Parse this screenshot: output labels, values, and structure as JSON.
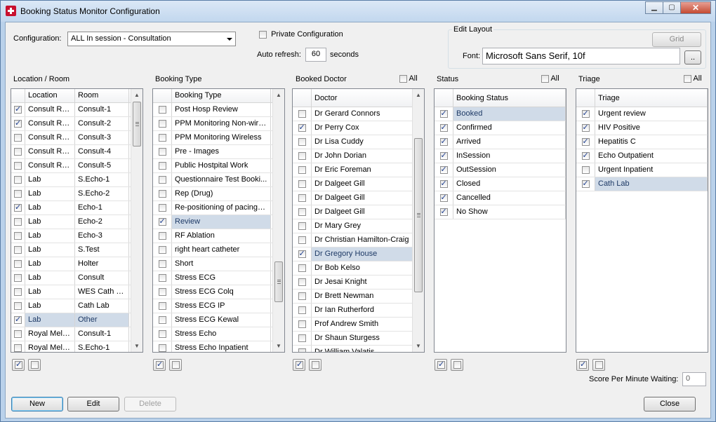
{
  "window": {
    "title": "Booking Status Monitor Configuration",
    "minimize_glyph": "▁",
    "maximize_glyph": "▢",
    "close_glyph": "✕"
  },
  "config": {
    "label": "Configuration:",
    "selected": "ALL In session - Consultation",
    "private_label": "Private Configuration",
    "private_checked": false,
    "auto_refresh_label": "Auto refresh:",
    "auto_refresh_value": "60",
    "auto_refresh_unit": "seconds"
  },
  "edit_layout": {
    "title": "Edit Layout",
    "grid_button": "Grid",
    "font_label": "Font:",
    "font_value": "Microsoft Sans Serif, 10f",
    "browse_button": ".."
  },
  "location": {
    "title": "Location / Room",
    "col_location": "Location",
    "col_room": "Room",
    "rows": [
      {
        "location": "Consult Ro...",
        "room": "Consult-1",
        "checked": true
      },
      {
        "location": "Consult Ro...",
        "room": "Consult-2",
        "checked": true
      },
      {
        "location": "Consult Ro...",
        "room": "Consult-3",
        "checked": false
      },
      {
        "location": "Consult Ro...",
        "room": "Consult-4",
        "checked": false
      },
      {
        "location": "Consult Ro...",
        "room": "Consult-5",
        "checked": false
      },
      {
        "location": "Lab",
        "room": "S.Echo-1",
        "checked": false
      },
      {
        "location": "Lab",
        "room": "S.Echo-2",
        "checked": false
      },
      {
        "location": "Lab",
        "room": "Echo-1",
        "checked": true
      },
      {
        "location": "Lab",
        "room": "Echo-2",
        "checked": false
      },
      {
        "location": "Lab",
        "room": "Echo-3",
        "checked": false
      },
      {
        "location": "Lab",
        "room": "S.Test",
        "checked": false
      },
      {
        "location": "Lab",
        "room": "Holter",
        "checked": false
      },
      {
        "location": "Lab",
        "room": "Consult",
        "checked": false
      },
      {
        "location": "Lab",
        "room": "WES Cath L...",
        "checked": false
      },
      {
        "location": "Lab",
        "room": "Cath Lab",
        "checked": false
      },
      {
        "location": "Lab",
        "room": "Other",
        "checked": true,
        "selected": true
      },
      {
        "location": "Royal Melb...",
        "room": "Consult-1",
        "checked": false
      },
      {
        "location": "Royal Melb...",
        "room": "S.Echo-1",
        "checked": false
      }
    ]
  },
  "booking_type": {
    "title": "Booking Type",
    "col": "Booking Type",
    "rows": [
      {
        "name": "Post Hosp Review",
        "checked": false
      },
      {
        "name": "PPM Monitoring Non-wirel...",
        "checked": false
      },
      {
        "name": "PPM Monitoring Wireless",
        "checked": false
      },
      {
        "name": "Pre - Images",
        "checked": false
      },
      {
        "name": "Public Hostpital Work",
        "checked": false
      },
      {
        "name": "Questionnaire Test Booki...",
        "checked": false
      },
      {
        "name": "Rep (Drug)",
        "checked": false
      },
      {
        "name": "Re-positioning of pacing l...",
        "checked": false
      },
      {
        "name": "Review",
        "checked": true,
        "selected": true
      },
      {
        "name": "RF Ablation",
        "checked": false
      },
      {
        "name": "right heart catheter",
        "checked": false
      },
      {
        "name": "Short",
        "checked": false
      },
      {
        "name": "Stress ECG",
        "checked": false
      },
      {
        "name": "Stress ECG Colq",
        "checked": false
      },
      {
        "name": "Stress ECG IP",
        "checked": false
      },
      {
        "name": "Stress ECG Kewal",
        "checked": false
      },
      {
        "name": "Stress Echo",
        "checked": false
      },
      {
        "name": "Stress Echo  Inpatient",
        "checked": false
      }
    ]
  },
  "doctor": {
    "title": "Booked Doctor",
    "all_label": "All",
    "col": "Doctor",
    "rows": [
      {
        "name": "Dr Gerard Connors",
        "checked": false
      },
      {
        "name": "Dr Perry Cox",
        "checked": true
      },
      {
        "name": "Dr Lisa Cuddy",
        "checked": false
      },
      {
        "name": "Dr John Dorian",
        "checked": false
      },
      {
        "name": "Dr Eric Foreman",
        "checked": false
      },
      {
        "name": "Dr Dalgeet Gill",
        "checked": false
      },
      {
        "name": "Dr Dalgeet Gill",
        "checked": false
      },
      {
        "name": "Dr Dalgeet Gill",
        "checked": false
      },
      {
        "name": "Dr Mary Grey",
        "checked": false
      },
      {
        "name": "Dr Christian Hamilton-Craig",
        "checked": false
      },
      {
        "name": "Dr Gregory House",
        "checked": true,
        "selected": true
      },
      {
        "name": "Dr Bob Kelso",
        "checked": false
      },
      {
        "name": "Dr Jesai Knight",
        "checked": false
      },
      {
        "name": "Dr Brett Newman",
        "checked": false
      },
      {
        "name": "Dr Ian Rutherford",
        "checked": false
      },
      {
        "name": "Prof Andrew Smith",
        "checked": false
      },
      {
        "name": "Dr Shaun Sturgess",
        "checked": false
      },
      {
        "name": "Dr William Valatis",
        "checked": false
      }
    ]
  },
  "status": {
    "title": "Status",
    "all_label": "All",
    "col": "Booking Status",
    "rows": [
      {
        "name": "Booked",
        "checked": true,
        "selected": true
      },
      {
        "name": "Confirmed",
        "checked": true
      },
      {
        "name": "Arrived",
        "checked": true
      },
      {
        "name": "InSession",
        "checked": true
      },
      {
        "name": "OutSession",
        "checked": true
      },
      {
        "name": "Closed",
        "checked": true
      },
      {
        "name": "Cancelled",
        "checked": true
      },
      {
        "name": "No Show",
        "checked": true
      }
    ]
  },
  "triage": {
    "title": "Triage",
    "all_label": "All",
    "col": "Triage",
    "rows": [
      {
        "name": "Urgent review",
        "checked": true
      },
      {
        "name": "HIV Positive",
        "checked": true
      },
      {
        "name": "Hepatitis C",
        "checked": true
      },
      {
        "name": "Echo Outpatient",
        "checked": true
      },
      {
        "name": "Urgent Inpatient",
        "checked": false
      },
      {
        "name": "Cath Lab",
        "checked": true,
        "selected": true
      }
    ]
  },
  "score": {
    "label": "Score Per Minute Waiting:",
    "value": "0"
  },
  "buttons": {
    "new": "New",
    "edit": "Edit",
    "delete": "Delete",
    "close": "Close"
  }
}
